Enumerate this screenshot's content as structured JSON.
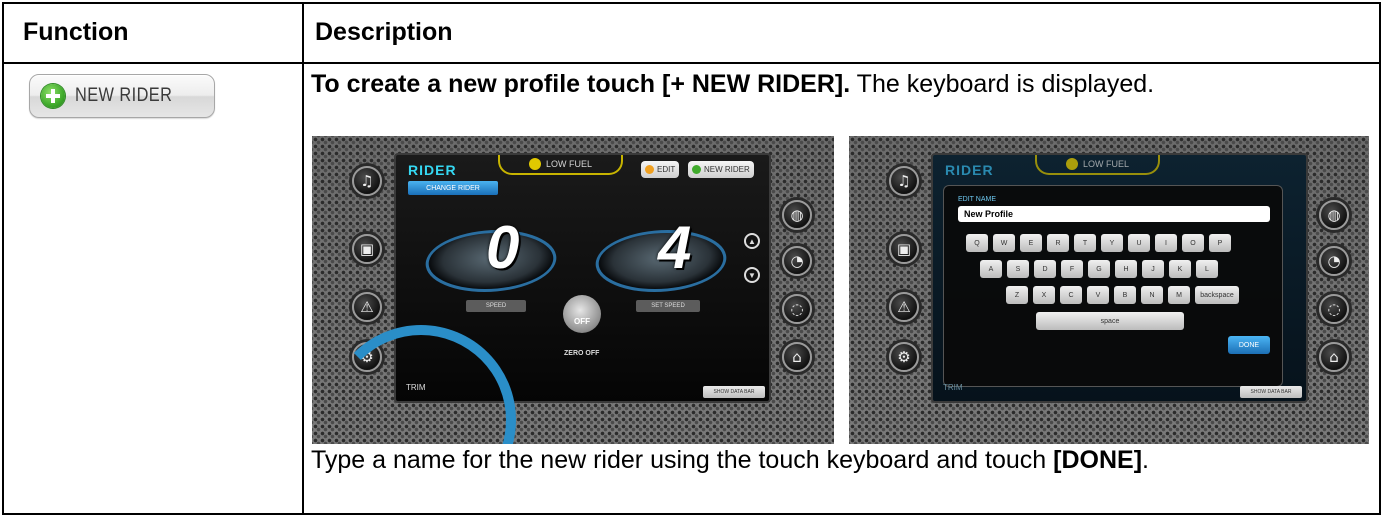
{
  "table": {
    "header_function": "Function",
    "header_description": "Description"
  },
  "new_rider_button": {
    "label": "NEW RIDER",
    "icon": "plus-circle-icon",
    "icon_color": "#3faa2b"
  },
  "paragraph1": {
    "bold": "To create a new profile touch [+ NEW RIDER].",
    "rest": " The keyboard is displayed."
  },
  "paragraph2": {
    "text": "Type a name for the new rider using the touch keyboard and touch ",
    "bold": "[DONE]",
    "end": "."
  },
  "screen1": {
    "title": "RIDER",
    "low_fuel": "LOW FUEL",
    "edit_btn": "EDIT",
    "new_rider_btn": "NEW RIDER",
    "change_rider": "CHANGE RIDER",
    "speed_value": "0",
    "set_speed_value": "4",
    "speed_label": "SPEED",
    "set_speed_label": "SET SPEED",
    "off_label": "OFF",
    "logo": "ZERO OFF",
    "trim": "TRIM",
    "show_data_bar": "SHOW DATA BAR"
  },
  "screen2": {
    "title": "RIDER",
    "low_fuel": "LOW FUEL",
    "edit_name_label": "EDIT NAME",
    "name_value": "New Profile",
    "keys_row1": [
      "Q",
      "W",
      "E",
      "R",
      "T",
      "Y",
      "U",
      "I",
      "O",
      "P"
    ],
    "keys_row2": [
      "A",
      "S",
      "D",
      "F",
      "G",
      "H",
      "J",
      "K",
      "L"
    ],
    "keys_row3": [
      "Z",
      "X",
      "C",
      "V",
      "B",
      "N",
      "M"
    ],
    "backspace": "backspace",
    "space": "space",
    "done": "DONE",
    "trim": "TRIM",
    "show_data_bar": "SHOW DATA BAR"
  }
}
